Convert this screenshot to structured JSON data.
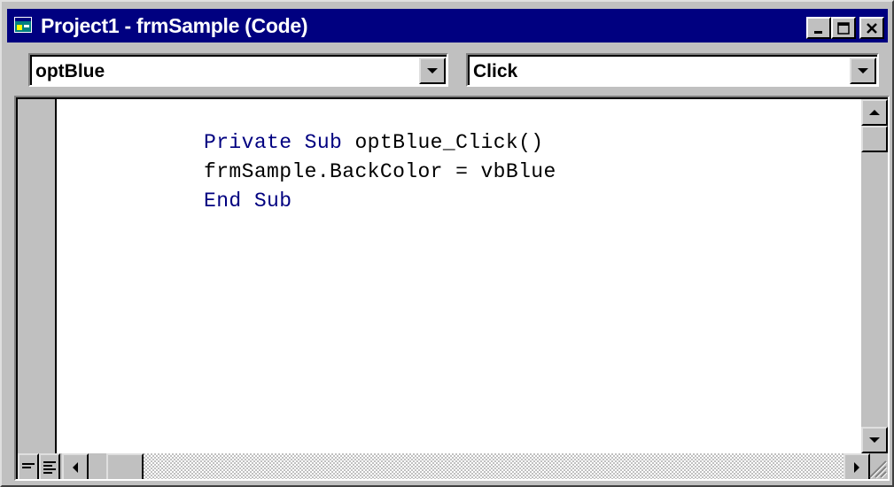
{
  "window": {
    "title": "Project1 - frmSample (Code)",
    "titlebar_color": "#000080",
    "icons": [
      "app-form-icon",
      "minimize-icon",
      "maximize-icon",
      "close-icon"
    ]
  },
  "object_combo": {
    "value": "optBlue"
  },
  "procedure_combo": {
    "value": "Click"
  },
  "code": {
    "lines": [
      {
        "parts": [
          {
            "text": "Private Sub ",
            "kind": "keyword"
          },
          {
            "text": "optBlue_Click()",
            "kind": "plain"
          }
        ]
      },
      {
        "parts": [
          {
            "text": "frmSample.BackColor = vbBlue",
            "kind": "plain"
          }
        ]
      },
      {
        "parts": [
          {
            "text": "End Sub",
            "kind": "keyword"
          }
        ]
      }
    ],
    "keyword_color": "#000080",
    "text_color": "#000000"
  },
  "view_buttons": [
    "procedure-view-icon",
    "full-module-view-icon"
  ],
  "scrollbars": {
    "vertical_position": 0,
    "horizontal_position": 0
  }
}
